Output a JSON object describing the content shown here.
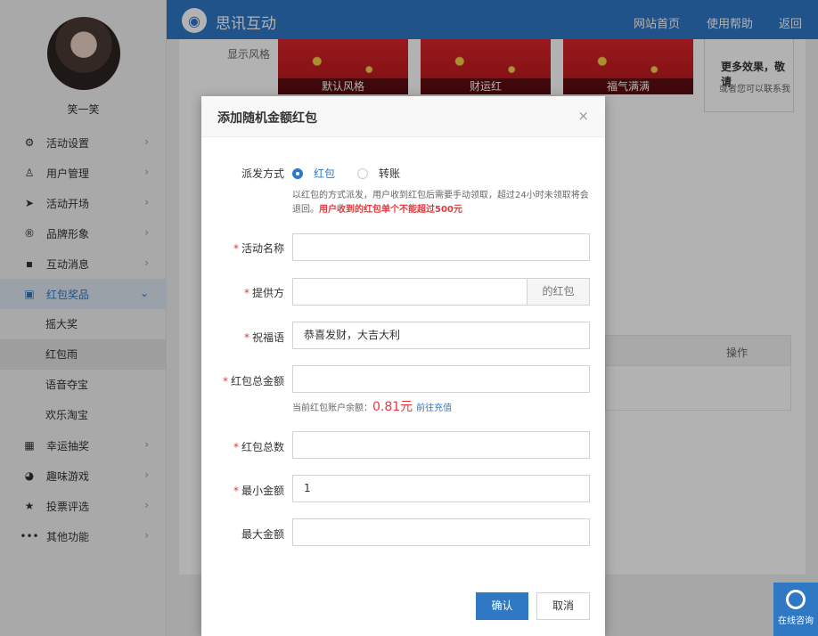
{
  "header": {
    "brand": "思讯互动",
    "nav": [
      "网站首页",
      "使用帮助",
      "返回"
    ]
  },
  "sidebar": {
    "username": "笑一笑",
    "items": [
      {
        "label": "活动设置",
        "icon": "gear-icon"
      },
      {
        "label": "用户管理",
        "icon": "user-icon"
      },
      {
        "label": "活动开场",
        "icon": "paper-plane-icon"
      },
      {
        "label": "品牌形象",
        "icon": "registered-icon"
      },
      {
        "label": "互动消息",
        "icon": "chat-icon"
      },
      {
        "label": "红包奖品",
        "icon": "gift-icon",
        "active": true
      },
      {
        "label": "幸运抽奖",
        "icon": "lottery-icon"
      },
      {
        "label": "趣味游戏",
        "icon": "game-icon"
      },
      {
        "label": "投票评选",
        "icon": "star-icon"
      },
      {
        "label": "其他功能",
        "icon": "more-icon"
      }
    ],
    "subitems": [
      "摇大奖",
      "红包雨",
      "语音夺宝",
      "欢乐淘宝"
    ],
    "arrow": "›",
    "arrow_down": "⌄"
  },
  "background": {
    "display_style_label": "显示风格",
    "thumb_captions": [
      "默认风格",
      "财运红",
      "福气满满"
    ],
    "more_title": "更多效果，敬请",
    "more_sub": "或者您可以联系我",
    "table_op": "操作"
  },
  "modal": {
    "title": "添加随机金额红包",
    "close": "×",
    "method": {
      "label": "派发方式",
      "options": [
        "红包",
        "转账"
      ],
      "selected": "红包",
      "note": "以红包的方式派发，用户收到红包后需要手动领取，超过24小时未领取将会退回。",
      "warning": "用户收到的红包单个不能超过500元"
    },
    "fields": {
      "activity_name": {
        "label": "活动名称",
        "value": ""
      },
      "provider": {
        "label": "提供方",
        "value": "",
        "suffix": "的红包"
      },
      "blessing": {
        "label": "祝福语",
        "value": "恭喜发财，大吉大利"
      },
      "total_amount": {
        "label": "红包总金额",
        "value": ""
      },
      "total_count": {
        "label": "红包总数",
        "value": ""
      },
      "min_amount": {
        "label": "最小金额",
        "value": "1"
      },
      "max_amount": {
        "label": "最大金额",
        "value": ""
      }
    },
    "balance": {
      "label": "当前红包账户余额：",
      "amount": "0.81元",
      "link": "前往充值"
    },
    "confirm": "确认",
    "cancel": "取消"
  },
  "consult": {
    "label": "在线咨询"
  }
}
